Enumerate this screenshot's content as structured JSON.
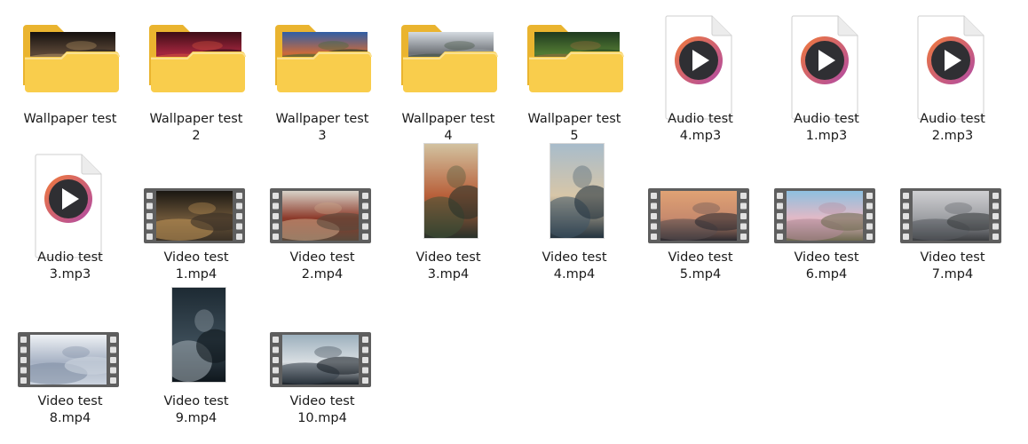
{
  "files": [
    {
      "name": "Wallpaper test",
      "kind": "folder",
      "palette": [
        "#15110f",
        "#5a4636",
        "#bd9b66",
        "#2c2724"
      ]
    },
    {
      "name": "Wallpaper test\n2",
      "kind": "folder",
      "palette": [
        "#3d0d16",
        "#a3263e",
        "#e05a3f",
        "#2a0f1c"
      ]
    },
    {
      "name": "Wallpaper test\n3",
      "kind": "folder",
      "palette": [
        "#2f5ea6",
        "#cd6a3a",
        "#3d6c30",
        "#1d3e22"
      ]
    },
    {
      "name": "Wallpaper test\n4",
      "kind": "folder",
      "palette": [
        "#d4dae0",
        "#6e7277",
        "#3c4c3a",
        "#9aa0a5"
      ]
    },
    {
      "name": "Wallpaper test\n5",
      "kind": "folder",
      "palette": [
        "#1f3a1f",
        "#527a33",
        "#a26e3c",
        "#2a4a24"
      ]
    },
    {
      "name": "Audio test\n4.mp3",
      "kind": "audio"
    },
    {
      "name": "Audio test\n1.mp3",
      "kind": "audio"
    },
    {
      "name": "Audio test\n2.mp3",
      "kind": "audio"
    },
    {
      "name": "Audio test\n3.mp3",
      "kind": "audio"
    },
    {
      "name": "Video test\n1.mp4",
      "kind": "video",
      "orientation": "landscape",
      "palette": [
        "#1a1712",
        "#6b5438",
        "#c99a5a",
        "#3a3126"
      ]
    },
    {
      "name": "Video test\n2.mp4",
      "kind": "video",
      "orientation": "landscape",
      "palette": [
        "#d8d2c8",
        "#8c3a2a",
        "#cfa889",
        "#5a4a3c"
      ]
    },
    {
      "name": "Video test\n3.mp4",
      "kind": "video",
      "orientation": "portrait",
      "palette": [
        "#d2c2a0",
        "#b8603a",
        "#3f5236",
        "#28322a"
      ]
    },
    {
      "name": "Video test\n4.mp4",
      "kind": "video",
      "orientation": "portrait",
      "palette": [
        "#a8bccb",
        "#d7c6a8",
        "#3f5566",
        "#23323e"
      ]
    },
    {
      "name": "Video test\n5.mp4",
      "kind": "video",
      "orientation": "landscape",
      "palette": [
        "#e0a274",
        "#c78a6d",
        "#5a4e50",
        "#2c2a30"
      ]
    },
    {
      "name": "Video test\n6.mp4",
      "kind": "video",
      "orientation": "landscape",
      "palette": [
        "#8ec0e0",
        "#e2b9c6",
        "#b58a9a",
        "#6e6a50"
      ]
    },
    {
      "name": "Video test\n7.mp4",
      "kind": "video",
      "orientation": "landscape",
      "palette": [
        "#cfcfd2",
        "#9ea0a4",
        "#5a5d62",
        "#3b3d40"
      ]
    },
    {
      "name": "Video test\n8.mp4",
      "kind": "video",
      "orientation": "landscape",
      "palette": [
        "#eef1f5",
        "#a7b2c4",
        "#7c8aa0",
        "#cbd3de"
      ]
    },
    {
      "name": "Video test\n9.mp4",
      "kind": "video",
      "orientation": "portrait",
      "palette": [
        "#1d2a33",
        "#3a4a55",
        "#a7b3ba",
        "#0f171d"
      ]
    },
    {
      "name": "Video test\n10.mp4",
      "kind": "video",
      "orientation": "landscape",
      "palette": [
        "#9cb0bd",
        "#d9dee2",
        "#34404a",
        "#1a2128"
      ]
    }
  ],
  "colors": {
    "folder_front": "#f9cd4c",
    "folder_back": "#eab42f",
    "folder_lip": "#fbe08f",
    "play_ring_a": "#f07a3a",
    "play_ring_b": "#b04aa6",
    "play_core": "#2f2f33",
    "reel_body": "#5e5e5e",
    "reel_hole": "#e2e2e2"
  },
  "icons": {
    "folder": "folder-icon",
    "audio": "audio-file-icon",
    "video": "video-file-icon"
  }
}
